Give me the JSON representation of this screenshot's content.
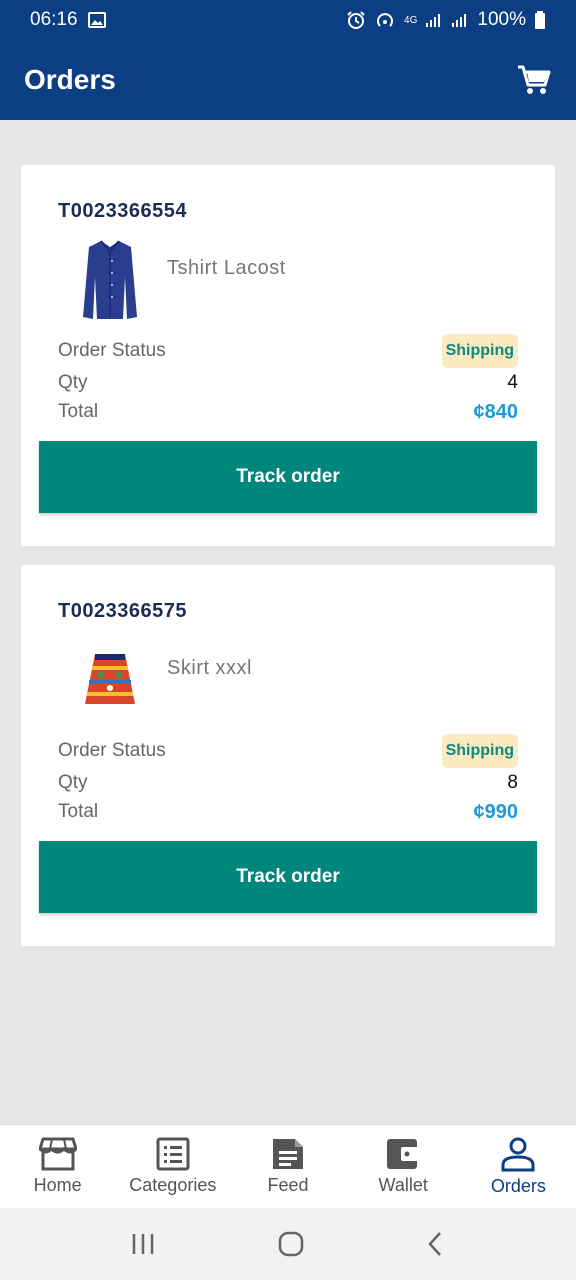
{
  "status_bar": {
    "time": "06:16",
    "battery": "100%",
    "network": "4G"
  },
  "app_bar": {
    "title": "Orders",
    "cart_icon": "cart-icon"
  },
  "orders": [
    {
      "id": "T0023366554",
      "product": "Tshirt Lacost",
      "status_label": "Order Status",
      "status": "Shipping",
      "qty_label": "Qty",
      "qty": "4",
      "total_label": "Total",
      "total": "¢840",
      "button": "Track order"
    },
    {
      "id": "T0023366575",
      "product": "Skirt xxxl",
      "status_label": "Order Status",
      "status": "Shipping",
      "qty_label": "Qty",
      "qty": "8",
      "total_label": "Total",
      "total": "¢990",
      "button": "Track order"
    }
  ],
  "bottom_nav": [
    {
      "label": "Home",
      "icon": "store-icon"
    },
    {
      "label": "Categories",
      "icon": "list-icon"
    },
    {
      "label": "Feed",
      "icon": "document-icon"
    },
    {
      "label": "Wallet",
      "icon": "wallet-icon"
    },
    {
      "label": "Orders",
      "icon": "person-icon",
      "active": true
    }
  ],
  "colors": {
    "primary": "#0b3e82",
    "button": "#00867d",
    "price": "#1f9ad6",
    "badge_bg": "#fbe9c2",
    "badge_text": "#0e8a7d"
  }
}
